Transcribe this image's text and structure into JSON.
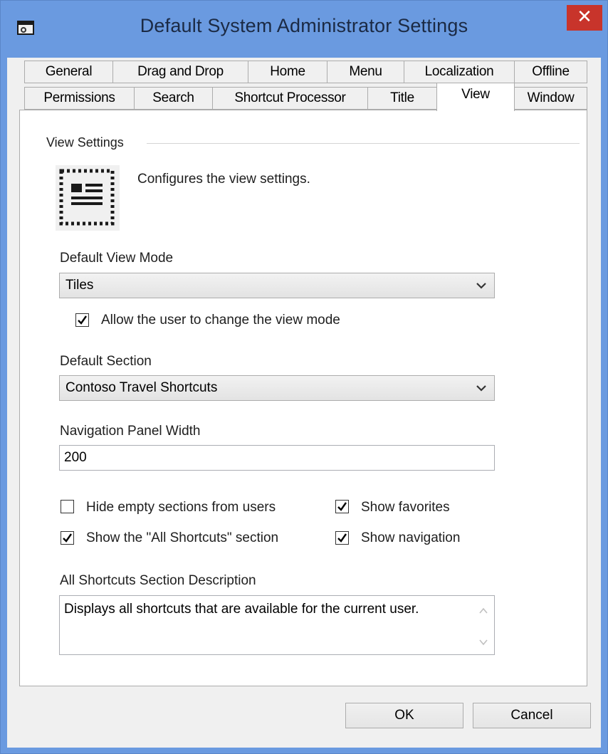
{
  "window": {
    "title": "Default System Administrator Settings",
    "close_glyph": "✕",
    "close_color": "#c8342b",
    "frame_color": "#6a9ae0"
  },
  "tabs": {
    "row1": [
      "General",
      "Drag and Drop",
      "Home",
      "Menu",
      "Localization",
      "Offline"
    ],
    "row2": [
      "Permissions",
      "Search",
      "Shortcut Processor",
      "Title",
      "View",
      "Window"
    ],
    "selected": "View"
  },
  "view_settings": {
    "group_label": "View Settings",
    "description": "Configures the view settings.",
    "icon": "view-settings-icon",
    "default_view_mode": {
      "label": "Default View Mode",
      "value": "Tiles"
    },
    "allow_change_view_mode": {
      "label": "Allow the user to change the view mode",
      "checked": true
    },
    "default_section": {
      "label": "Default Section",
      "value": "Contoso Travel Shortcuts"
    },
    "navigation_panel_width": {
      "label": "Navigation Panel Width",
      "value": "200"
    },
    "hide_empty_sections": {
      "label": "Hide empty sections from users",
      "checked": false
    },
    "show_favorites": {
      "label": "Show favorites",
      "checked": true
    },
    "show_all_shortcuts": {
      "label": "Show the \"All Shortcuts\" section",
      "checked": true
    },
    "show_navigation": {
      "label": "Show navigation",
      "checked": true
    },
    "all_shortcuts_description": {
      "label": "All Shortcuts Section Description",
      "value": "Displays all shortcuts that are available for the current user."
    }
  },
  "buttons": {
    "ok": "OK",
    "cancel": "Cancel"
  }
}
